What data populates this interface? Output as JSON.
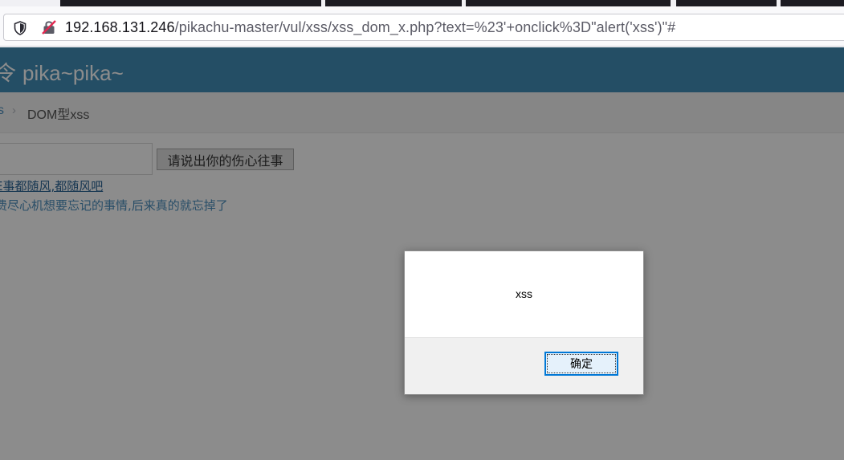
{
  "browser": {
    "url_host": "192.168.131.246",
    "url_path": "/pikachu-master/vul/xss/xss_dom_x.php?text=%23'+onclick%3D\"alert('xss')\"#",
    "shield_icon": "shield-icon",
    "insecure_icon": "insecure-connection-icon"
  },
  "page": {
    "brand_glyph": "令",
    "brand": "pika~pika~",
    "breadcrumb_prev": "s",
    "breadcrumb_sep": "›",
    "breadcrumb_current": "DOM型xss",
    "input_value": "",
    "submit_label": "请说出你的伤心往事",
    "link1_text": "E事都随风,都随风吧",
    "link2_text": "费尽心机想要忘记的事情,后来真的就忘掉了"
  },
  "dialog": {
    "message": "xss",
    "ok_label": "确定"
  },
  "colors": {
    "header": "#438eb9",
    "overlay": "rgba(0,0,0,0.45)",
    "focus": "#0078d7"
  }
}
